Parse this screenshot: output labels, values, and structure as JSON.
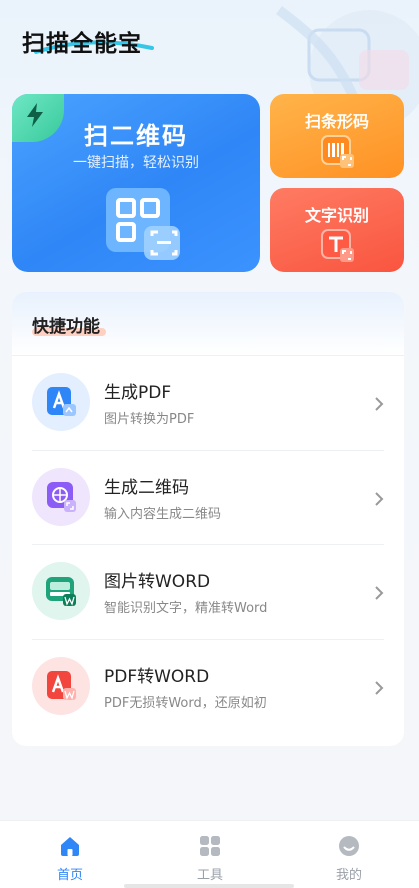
{
  "app": {
    "title": "扫描全能宝"
  },
  "cards": {
    "scan_qr": {
      "title": "扫二维码",
      "subtitle": "一键扫描，轻松识别"
    },
    "scan_barcode": {
      "title": "扫条形码"
    },
    "text_recognition": {
      "title": "文字识别"
    }
  },
  "quick": {
    "title": "快捷功能",
    "items": [
      {
        "title": "生成PDF",
        "desc": "图片转换为PDF",
        "icon": "pdf-icon",
        "color": "#2f86f6"
      },
      {
        "title": "生成二维码",
        "desc": "输入内容生成二维码",
        "icon": "qrcode-icon",
        "color": "#8b5cf6"
      },
      {
        "title": "图片转WORD",
        "desc": "智能识别文字，精准转Word",
        "icon": "image-to-word-icon",
        "color": "#1fa37a"
      },
      {
        "title": "PDF转WORD",
        "desc": "PDF无损转Word，还原如初",
        "icon": "pdf-to-word-icon",
        "color": "#f2453d"
      }
    ]
  },
  "tabbar": {
    "items": [
      {
        "label": "首页",
        "icon": "home-icon",
        "active": true
      },
      {
        "label": "工具",
        "icon": "grid-icon",
        "active": false
      },
      {
        "label": "我的",
        "icon": "smile-icon",
        "active": false
      }
    ]
  },
  "colors": {
    "accent": "#2f86f6",
    "inactive": "#b5b9c0"
  }
}
